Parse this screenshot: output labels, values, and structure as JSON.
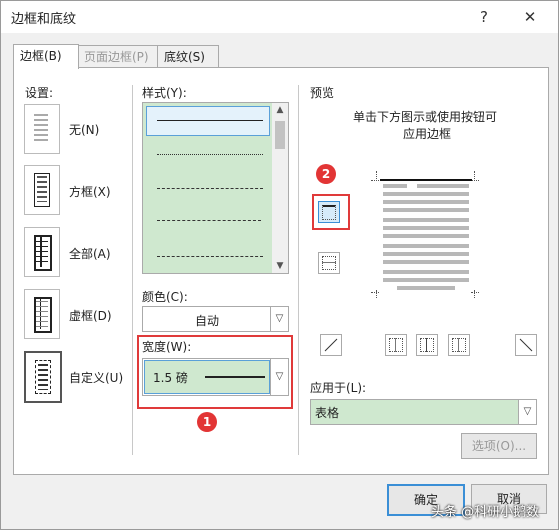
{
  "window": {
    "title": "边框和底纹",
    "help": "?",
    "close": "✕"
  },
  "tabs": [
    {
      "label": "边框(B)"
    },
    {
      "label": "页面边框(P)"
    },
    {
      "label": "底纹(S)"
    }
  ],
  "settings": {
    "heading": "设置:",
    "items": [
      {
        "label": "无(N)"
      },
      {
        "label": "方框(X)"
      },
      {
        "label": "全部(A)"
      },
      {
        "label": "虚框(D)"
      },
      {
        "label": "自定义(U)"
      }
    ]
  },
  "style": {
    "label": "样式(Y):"
  },
  "color": {
    "label": "颜色(C):",
    "value": "自动"
  },
  "width": {
    "label": "宽度(W):",
    "value": "1.5 磅"
  },
  "preview": {
    "heading": "预览",
    "hint_line1": "单击下方图示或使用按钮可",
    "hint_line2": "应用边框"
  },
  "apply_to": {
    "label": "应用于(L):",
    "value": "表格"
  },
  "options_button": "选项(O)...",
  "ok_button": "确定",
  "cancel_button": "取消",
  "annotations": {
    "badge1": "1",
    "badge2": "2"
  },
  "watermark": "头条 @科研小鹅数"
}
